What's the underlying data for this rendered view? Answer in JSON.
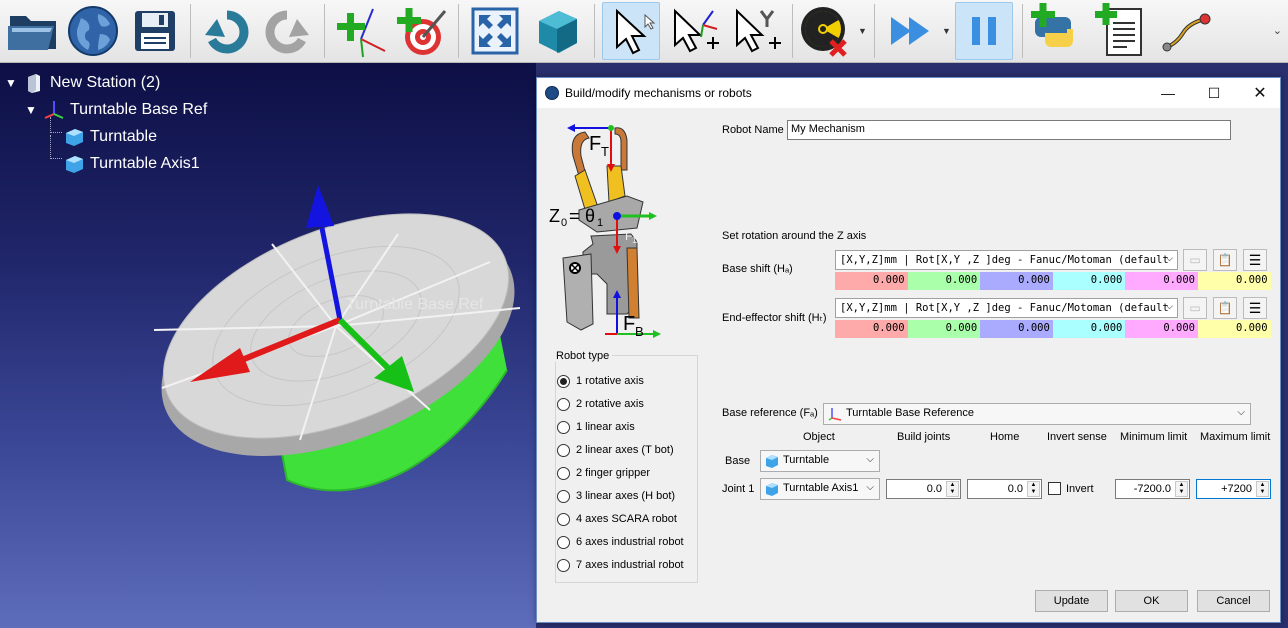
{
  "toolbar": {
    "icons": [
      "open-folder-icon",
      "globe-icon",
      "save-icon",
      "undo-icon",
      "redo-icon",
      "add-reference-frame-icon",
      "add-target-icon",
      "fit-all-icon",
      "3d-cube-icon",
      "select-pointer-icon",
      "move-reference-icon",
      "move-object-icon",
      "collision-check-icon",
      "run-fast-icon",
      "pause-icon",
      "add-python-icon",
      "add-program-icon",
      "path-icon"
    ],
    "overflow": "⌄"
  },
  "tree": {
    "station": "New Station (2)",
    "base_ref": "Turntable Base Ref",
    "items": [
      "Turntable",
      "Turntable Axis1"
    ]
  },
  "scene": {
    "label": "Turntable Base Ref"
  },
  "dialog": {
    "title": "Build/modify mechanisms or robots",
    "diagram": {
      "ft": "F",
      "ft_sub": "T",
      "z0": "Z",
      "z0_sub": "0",
      "eq": "=",
      "theta": "θ",
      "theta_sub": "1",
      "fb": "F",
      "fb_sub": "B",
      "small": "F",
      "small_sub": "1/3"
    },
    "robot_name_label": "Robot Name",
    "robot_name_value": "My Mechanism",
    "z_rotation_label": "Set rotation around the Z axis",
    "base_shift": {
      "label": "Base shift (Hₐ)",
      "format": "[X,Y,Z]mm | Rot[X,Y ,Z  ]deg - Fanuc/Motoman (default",
      "values": [
        "0.000",
        "0.000",
        "0.000",
        "0.000",
        "0.000",
        "0.000"
      ]
    },
    "ee_shift": {
      "label": "End-effector shift (Hₜ)",
      "format": "[X,Y,Z]mm | Rot[X,Y ,Z  ]deg - Fanuc/Motoman (default",
      "values": [
        "0.000",
        "0.000",
        "0.000",
        "0.000",
        "0.000",
        "0.000"
      ]
    },
    "value_colors": [
      "#ffaaaa",
      "#aaffaa",
      "#aaaaff",
      "#aaffff",
      "#ffaaff",
      "#ffffaa"
    ],
    "robot_type": {
      "title": "Robot type",
      "options": [
        "1 rotative axis",
        "2 rotative axis",
        "1 linear axis",
        "2 linear axes (T bot)",
        "2 finger gripper",
        "3 linear axes (H bot)",
        "4 axes SCARA robot",
        "6 axes industrial robot",
        "7 axes industrial robot"
      ],
      "selected": 0
    },
    "base_reference": {
      "label": "Base reference (Fₐ)",
      "value": "Turntable Base Reference"
    },
    "columns": [
      "Object",
      "Build joints",
      "Home",
      "Invert sense",
      "Minimum limit",
      "Maximum limit"
    ],
    "base_row": {
      "label": "Base",
      "object": "Turntable"
    },
    "joint_row": {
      "label": "Joint 1",
      "object": "Turntable Axis1",
      "build": "0.0",
      "home": "0.0",
      "invert_label": "Invert",
      "min": "-7200.0",
      "max": "+7200"
    },
    "buttons": {
      "update": "Update",
      "ok": "OK",
      "cancel": "Cancel"
    }
  }
}
